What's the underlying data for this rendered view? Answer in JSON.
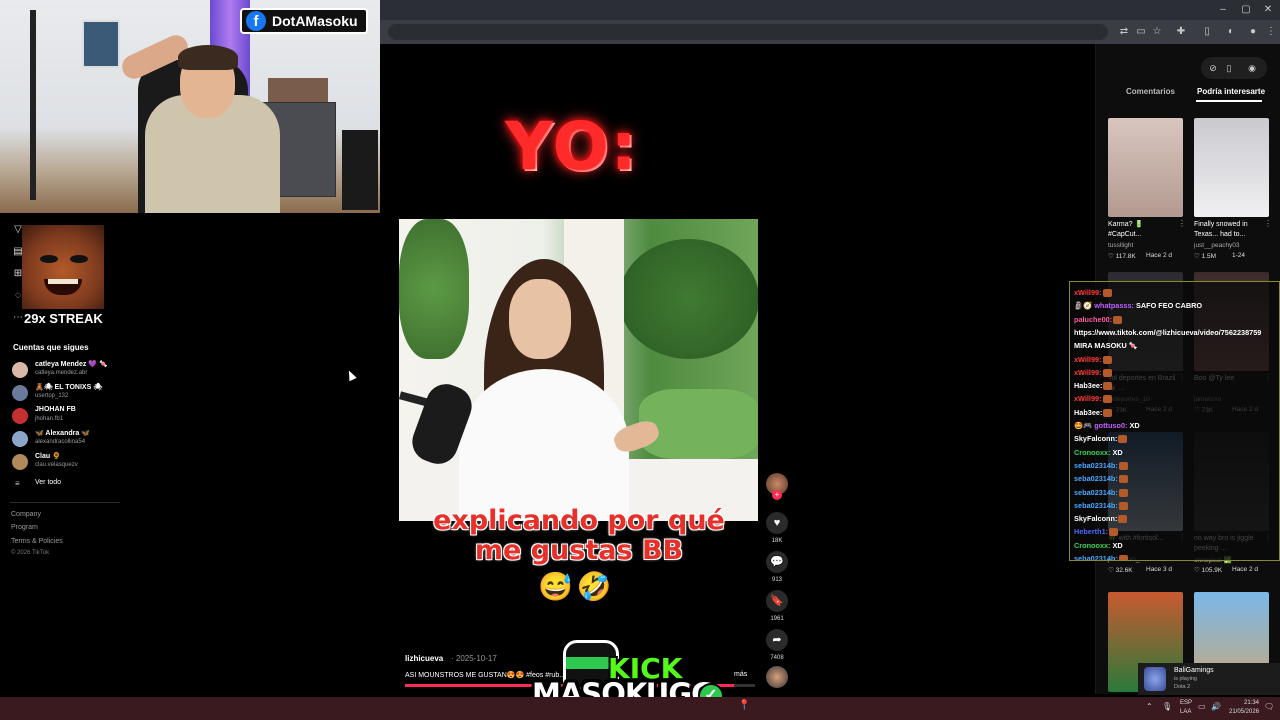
{
  "webcam": {
    "facebook_name": "DotAMasoku",
    "streak_label": "29x STREAK"
  },
  "browser": {
    "window_buttons": [
      "–",
      "▢",
      "✕"
    ]
  },
  "tiktok": {
    "following_title": "Cuentas que sigues",
    "accounts": [
      {
        "name": "catleya Mendez 💜 🍬",
        "user": "catleya.mendez.abr",
        "color": "#d9b8a8"
      },
      {
        "name": "🧸🕷 EL TONIXS 🕷",
        "user": "usertop_132",
        "color": "#6a7a9a"
      },
      {
        "name": "JHOHAN FB",
        "user": "jhohan.fb1",
        "color": "#c23030"
      },
      {
        "name": "🦋 Alexandra 🦋",
        "user": "alexandracollina54",
        "color": "#8aa6c8"
      },
      {
        "name": "Clau 🌻",
        "user": "clau.velasquezv",
        "color": "#b08a5a"
      }
    ],
    "see_all": "Ver todo",
    "footer_links": [
      "Company",
      "Program",
      "Terms & Policies"
    ],
    "copyright": "© 2026 TikTok",
    "video": {
      "top_text": "YO:",
      "caption_line1": "explicando por qué",
      "caption_line2": "me gustas BB",
      "caption_emojis": "😅🤣",
      "author": "lizhicueva",
      "date": "· 2025-10-17",
      "description": "ASI MOUNSTROS ME GUSTAN😍😍 #feos #rub... 🍀 ...stanfoos",
      "more": "más",
      "progress": 0.94
    },
    "actions": [
      {
        "icon": "♥",
        "count": "18K",
        "name": "like"
      },
      {
        "icon": "💬",
        "count": "913",
        "name": "comment"
      },
      {
        "icon": "🔖",
        "count": "1961",
        "name": "save"
      },
      {
        "icon": "➦",
        "count": "7408",
        "name": "share"
      }
    ]
  },
  "kick": {
    "word": "KICK",
    "username": "MASOKUGG",
    "check": "✓"
  },
  "panel": {
    "tabs": [
      "Comentarios",
      "Podría interesarte"
    ],
    "active_tab": 1,
    "thumbs": [
      {
        "title": "Karma? 🔋 #CapCut...",
        "user": "tussllight",
        "likes": "♡ 117.8K",
        "age": "Hace 2 d",
        "bg": "linear-gradient(#d8c6bf,#b39a90)"
      },
      {
        "title": "Finally snowed in Texas... had to...",
        "user": "just__peachy03",
        "likes": "♡ 1.5M",
        "age": "1-24",
        "bg": "linear-gradient(#c9c9cf,#f0f0f2)"
      },
      {
        "title": "Tol deportes en Brazil 🐐 ...",
        "user": "todeportes_10",
        "likes": "♡ 73K",
        "age": "Hace 2 d",
        "bg": "linear-gradient(#2a2a30,#555)"
      },
      {
        "title": "Boo @Ty lee",
        "user": "jamelizxo",
        "likes": "♡ 73K",
        "age": "Hace 2 d",
        "bg": "linear-gradient(#3a2a2a,#8a5a5a)"
      },
      {
        "title": "🍀 with #fortisol...",
        "user": "jannik.fan_",
        "likes": "♡ 32.6K",
        "age": "Hace 3 d",
        "bg": "linear-gradient(#2a5a8a,#c8d8e8)"
      },
      {
        "title": "no way bro is jiggle peeking ...",
        "user": "ohnepixel ✅",
        "likes": "♡ 105.9K",
        "age": "Hace 2 d",
        "bg": "linear-gradient(#1a1a1a,#3a3a3a)"
      },
      {
        "title": "",
        "user": "",
        "likes": "",
        "age": "",
        "bg": "linear-gradient(#c85a30,#2a7a3a)"
      },
      {
        "title": "",
        "user": "",
        "likes": "",
        "age": "",
        "bg": "linear-gradient(#7ab8e8,#c8a87a)"
      }
    ]
  },
  "chat": {
    "lines": [
      {
        "user": "xWill99:",
        "msg": "",
        "ucolor": "#ff3a3a",
        "emote": true
      },
      {
        "user": "🗿🧭 whatpasss:",
        "msg": " SAFO FEO CABRO",
        "ucolor": "#c060ff",
        "emote": false
      },
      {
        "user": "paluche00:",
        "msg": "",
        "ucolor": "#ff5aa0",
        "emote": true
      },
      {
        "user": "https://www.tiktok.com/@lizhicueva/video/7562238759",
        "msg": "",
        "ucolor": "#ffffff",
        "emote": false
      },
      {
        "user": "MIRA MASOKU",
        "msg": " 🍬",
        "ucolor": "#ffffff",
        "emote": false
      },
      {
        "user": "xWill99:",
        "msg": "",
        "ucolor": "#ff3a3a",
        "emote": true
      },
      {
        "user": "xWill99:",
        "msg": "",
        "ucolor": "#ff3a3a",
        "emote": true
      },
      {
        "user": "Hab3ee:",
        "msg": "",
        "ucolor": "#ffffff",
        "emote": true
      },
      {
        "user": "xWill99:",
        "msg": "",
        "ucolor": "#ff3a3a",
        "emote": true
      },
      {
        "user": "Hab3ee:",
        "msg": "",
        "ucolor": "#ffffff",
        "emote": true
      },
      {
        "user": "🤩🎮 gottuso0:",
        "msg": " XD",
        "ucolor": "#c060ff",
        "emote": false
      },
      {
        "user": "SkyFalconn:",
        "msg": "",
        "ucolor": "#ffffff",
        "emote": true
      },
      {
        "user": "Cronooxx:",
        "msg": " XD",
        "ucolor": "#39d353",
        "emote": false
      },
      {
        "user": "seba02314b:",
        "msg": "",
        "ucolor": "#4aa8ff",
        "emote": true
      },
      {
        "user": "seba02314b:",
        "msg": "",
        "ucolor": "#4aa8ff",
        "emote": true
      },
      {
        "user": "seba02314b:",
        "msg": "",
        "ucolor": "#4aa8ff",
        "emote": true
      },
      {
        "user": "seba02314b:",
        "msg": "",
        "ucolor": "#4aa8ff",
        "emote": true
      },
      {
        "user": "SkyFalconn:",
        "msg": "",
        "ucolor": "#ffffff",
        "emote": true
      },
      {
        "user": "Heberth1:",
        "msg": "",
        "ucolor": "#4a6aff",
        "emote": true
      },
      {
        "user": "Cronooxx:",
        "msg": " XD",
        "ucolor": "#39d353",
        "emote": false
      },
      {
        "user": "seba02314b:",
        "msg": "",
        "ucolor": "#4aa8ff",
        "emote": true
      }
    ]
  },
  "notification": {
    "name": "BaliGamings",
    "status": "is playing",
    "game": "Dota 2"
  },
  "taskbar": {
    "lang": "ESP",
    "lang2": "LAA",
    "time": "21:34",
    "date": "21/05/2026"
  }
}
